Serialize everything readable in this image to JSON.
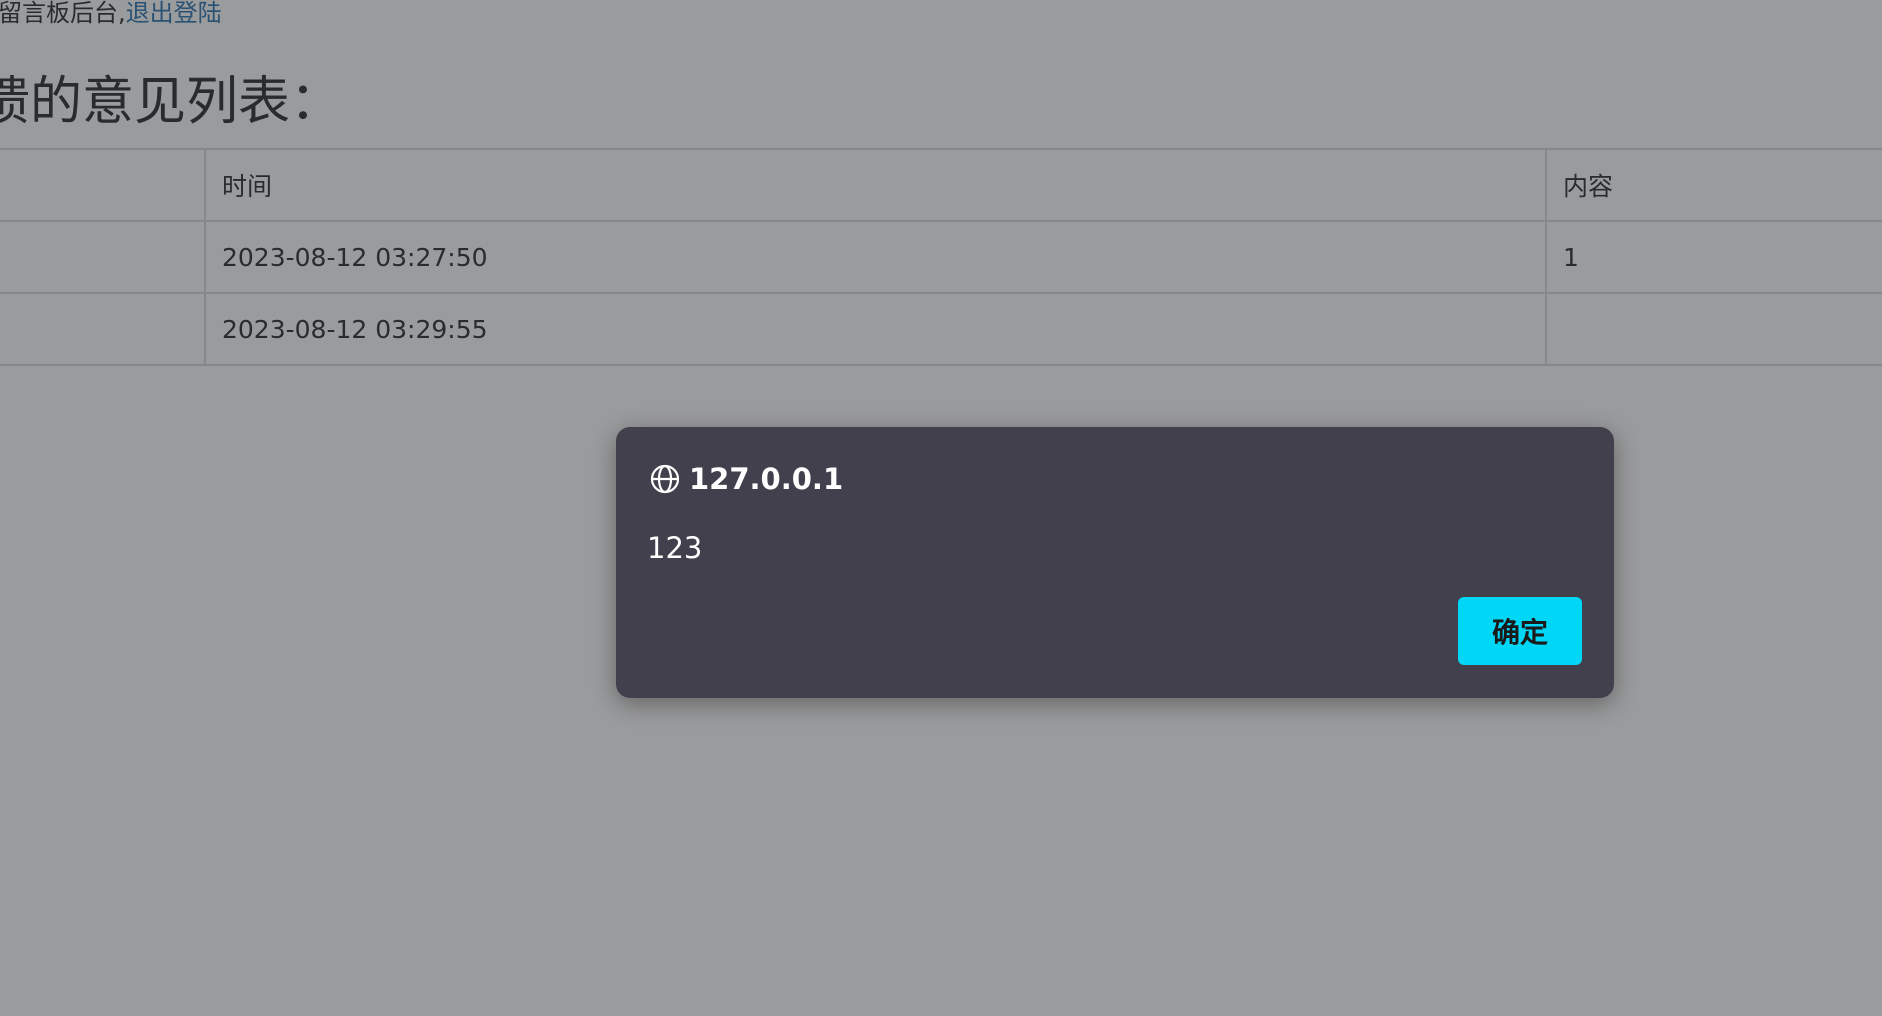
{
  "page": {
    "top_text": "留言板后台,",
    "logout_link": "退出登陆",
    "heading": "馈的意见列表：",
    "table": {
      "headers": [
        "",
        "时间",
        "内容"
      ],
      "rows": [
        [
          "",
          "2023-08-12 03:27:50",
          "1"
        ],
        [
          "",
          "2023-08-12 03:29:55",
          ""
        ]
      ]
    }
  },
  "dialog": {
    "origin": "127.0.0.1",
    "message": "123",
    "ok_label": "确定",
    "icon": "globe-icon",
    "button_color": "#00d6f5",
    "background_color": "#42404d"
  }
}
